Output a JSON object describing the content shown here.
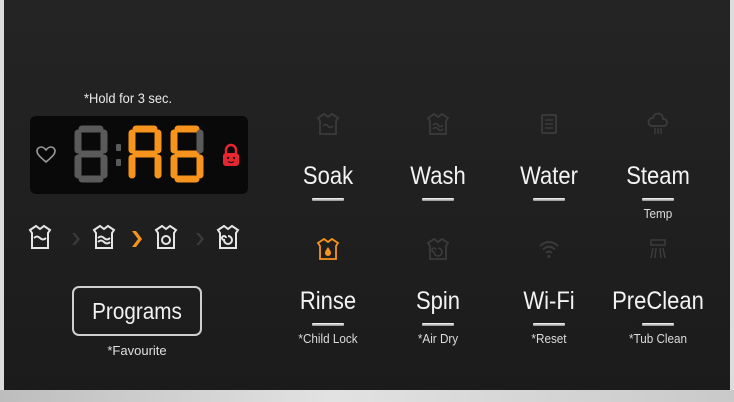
{
  "display": {
    "hold_note": "*Hold for 3 sec.",
    "digits": [
      "8",
      ":",
      "A",
      "6"
    ],
    "heart_icon": "heart-icon",
    "lock_icon": "child-lock-icon",
    "lock_color": "#e8262f",
    "digit_color": "#f7941d",
    "dim_segment_color": "#5a5a5a"
  },
  "programs": {
    "label": "Programs",
    "sub": "*Favourite"
  },
  "functions": [
    {
      "key": "soak",
      "label": "Soak",
      "sub": "",
      "icon": "soak-icon",
      "active": false
    },
    {
      "key": "wash",
      "label": "Wash",
      "sub": "",
      "icon": "wash-icon",
      "active": false
    },
    {
      "key": "water",
      "label": "Water",
      "sub": "",
      "icon": "water-level-icon",
      "active": false
    },
    {
      "key": "steam",
      "label": "Steam",
      "sub": "Temp",
      "icon": "steam-icon",
      "active": false
    },
    {
      "key": "rinse",
      "label": "Rinse",
      "sub": "*Child Lock",
      "icon": "rinse-icon",
      "active": true
    },
    {
      "key": "spin",
      "label": "Spin",
      "sub": "*Air Dry",
      "icon": "spin-icon",
      "active": false
    },
    {
      "key": "wifi",
      "label": "Wi-Fi",
      "sub": "*Reset",
      "icon": "wifi-icon",
      "active": false
    },
    {
      "key": "preclean",
      "label": "PreClean",
      "sub": "*Tub Clean",
      "icon": "preclean-icon",
      "active": false
    }
  ],
  "cycle_icons": [
    "wash-stage-icon",
    "rinse-stage-icon",
    "spin-stage-icon",
    "dry-stage-icon"
  ],
  "active_color": "#f7941d"
}
